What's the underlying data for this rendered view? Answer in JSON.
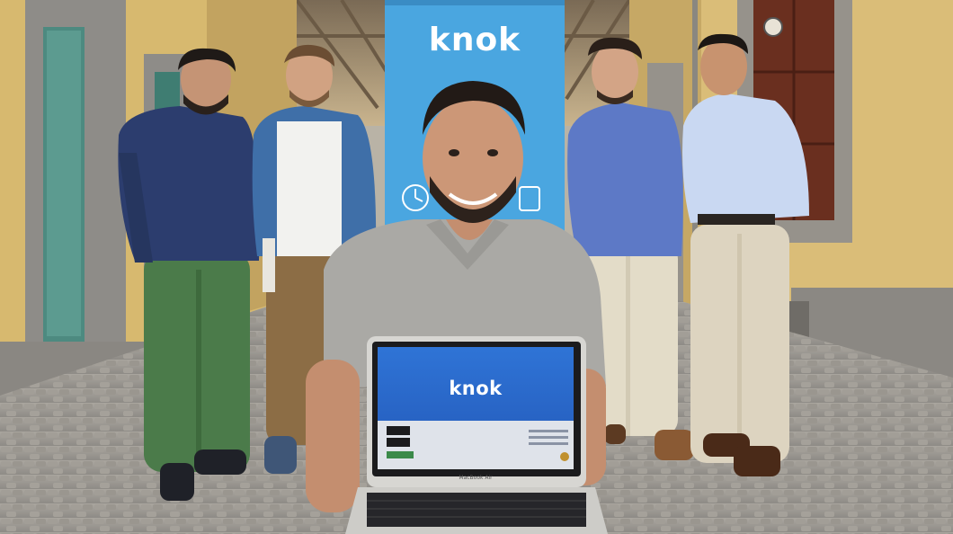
{
  "banner": {
    "logo_text": "knok"
  },
  "laptop": {
    "screen_logo_text": "knok",
    "model_label": "MacBook Air"
  },
  "colors": {
    "banner_blue": "#4aa6e0",
    "screen_blue": "#2b6ed1",
    "wall_yellow": "#d9bd79",
    "stone_grey": "#8f8c86",
    "cobblestone": "#9b9892"
  }
}
